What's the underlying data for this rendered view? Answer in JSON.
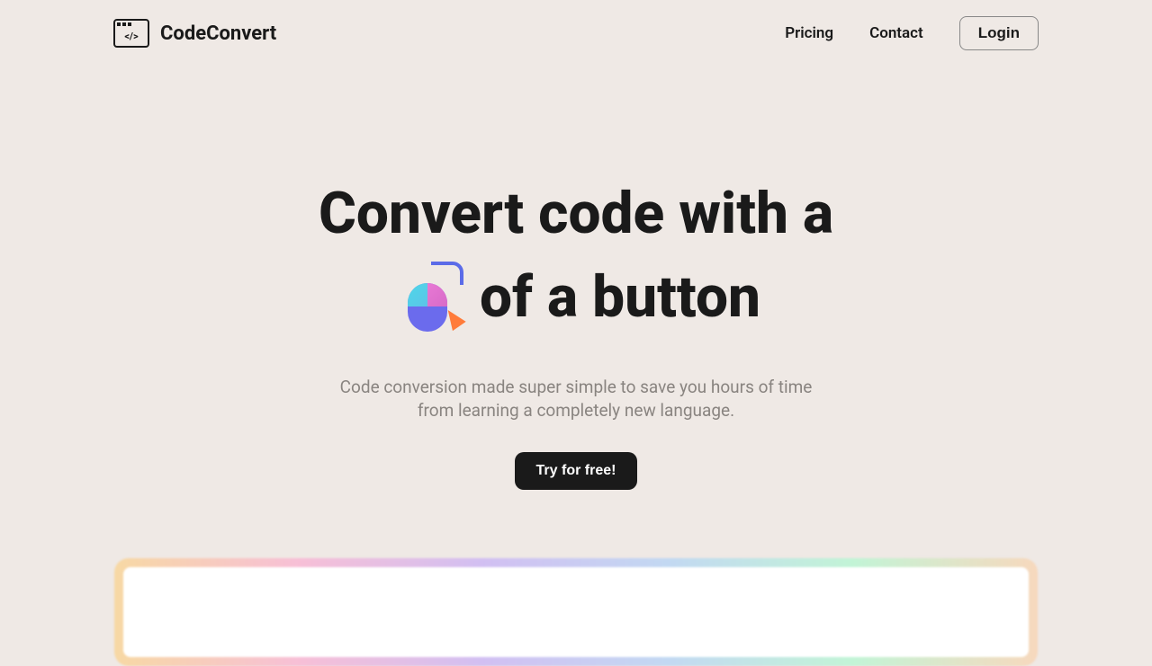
{
  "header": {
    "logo_text": "CodeConvert",
    "nav": {
      "pricing": "Pricing",
      "contact": "Contact",
      "login": "Login"
    }
  },
  "hero": {
    "title_line1": "Convert code with a",
    "title_line2_suffix": "of a button",
    "subtitle_line1": "Code conversion made super simple to save you hours of time",
    "subtitle_line2": "from learning a completely new language.",
    "cta": "Try for free!"
  }
}
